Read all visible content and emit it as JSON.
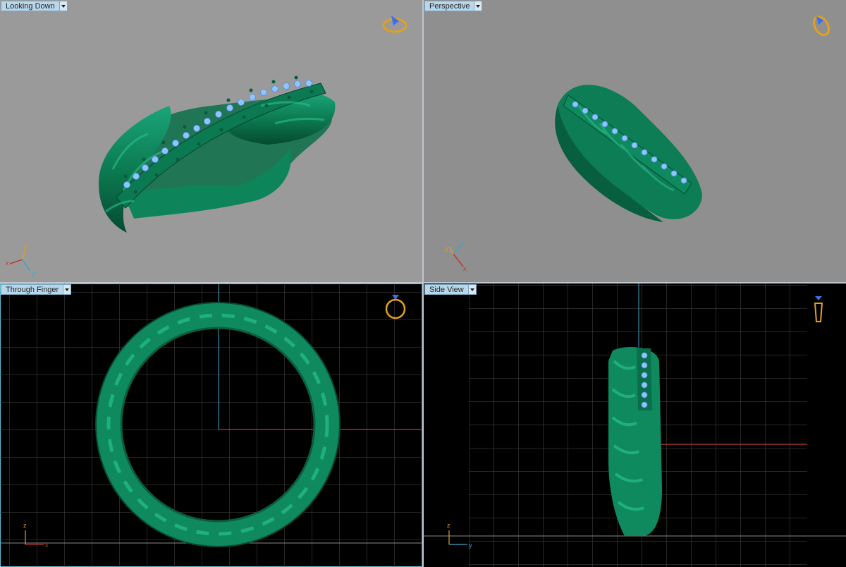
{
  "viewports": {
    "top_left": {
      "label": "Looking Down"
    },
    "top_right": {
      "label": "Perspective"
    },
    "bottom_left": {
      "label": "Through Finger"
    },
    "bottom_right": {
      "label": "Side View"
    }
  },
  "axes": {
    "x": "x",
    "y": "y",
    "z": "z"
  },
  "icons": {
    "view_cube": "ring-view-icon",
    "dropdown": "chevron-down-icon"
  },
  "colors": {
    "ring_green": "#0f8a5e",
    "gem_blue": "#7fb8ff",
    "grid_line": "#4b4b4b",
    "x_axis": "#c0392b",
    "y_axis": "#3aa6c9",
    "z_axis": "#e0a020",
    "viewport_gray": "#9a9a9a",
    "label_bg": "#b9d7ea"
  }
}
